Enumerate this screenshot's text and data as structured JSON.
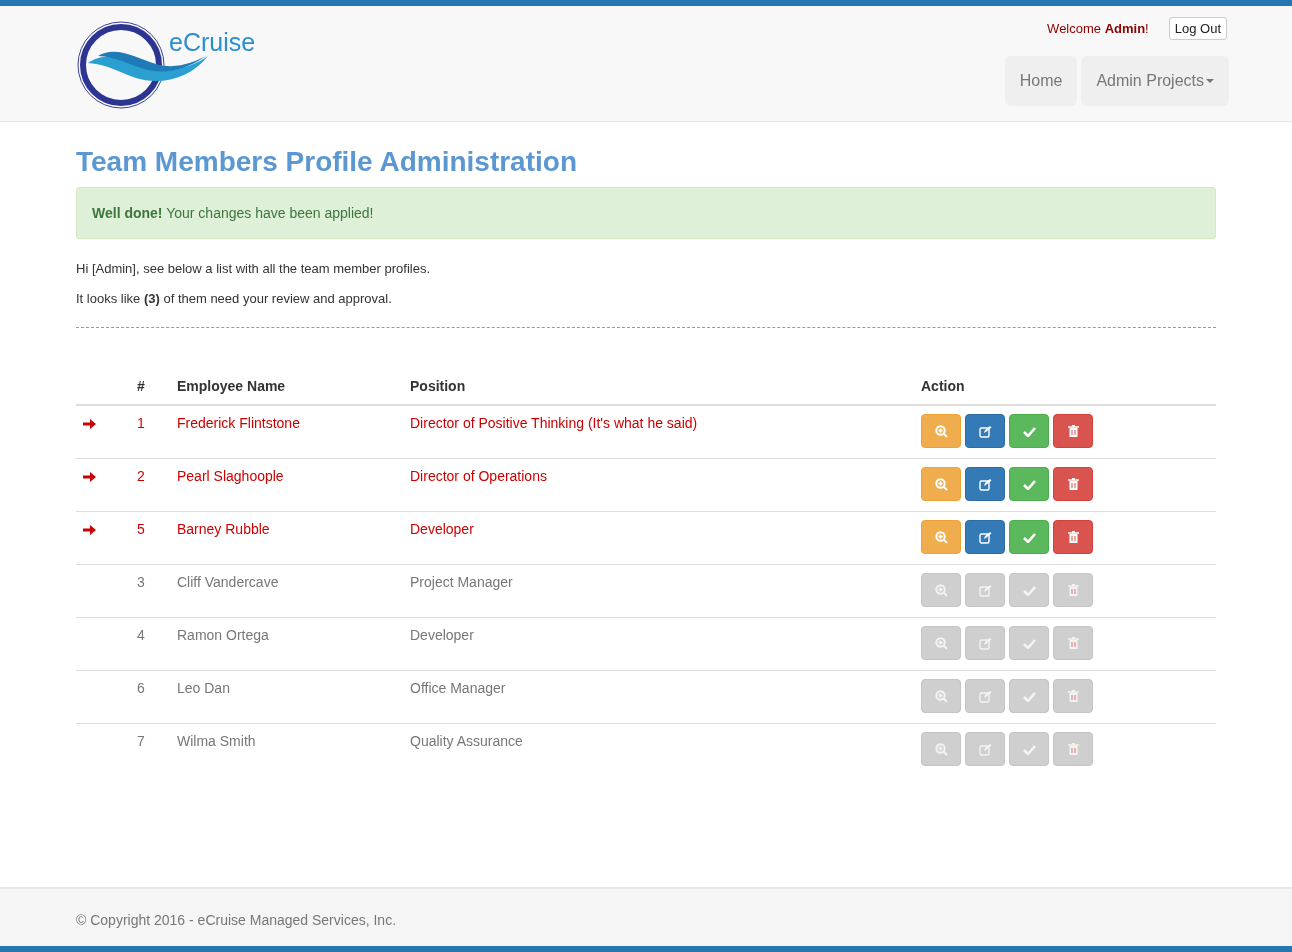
{
  "header": {
    "logo_text": "eCruise",
    "welcome": "Welcome **Admin**!",
    "logout": "Log Out",
    "nav": [
      {
        "label": "Home",
        "dropdown": false
      },
      {
        "label": "Admin Projects",
        "dropdown": true
      }
    ]
  },
  "page": {
    "title": "Team Members Profile Administration",
    "alert": "**Well done!** Your changes have been applied!",
    "intro": [
      "Hi [Admin], see below a list with all the team member profiles.",
      "It looks like **(3)** of them need your review and approval."
    ]
  },
  "table": {
    "columns": [
      "#",
      "Employee Name",
      "Position",
      "Action"
    ],
    "rows": [
      {
        "number": "1",
        "name": "Frederick Flintstone",
        "position": "Director of Positive Thinking (It's what he said)",
        "pending": true
      },
      {
        "number": "2",
        "name": "Pearl Slaghoople",
        "position": "Director of Operations",
        "pending": true
      },
      {
        "number": "5",
        "name": "Barney Rubble",
        "position": "Developer",
        "pending": true
      },
      {
        "number": "3",
        "name": "Cliff Vandercave",
        "position": "Project Manager",
        "pending": false
      },
      {
        "number": "4",
        "name": "Ramon Ortega",
        "position": "Developer",
        "pending": false
      },
      {
        "number": "6",
        "name": "Leo Dan",
        "position": "Office Manager",
        "pending": false
      },
      {
        "number": "7",
        "name": "Wilma Smith",
        "position": "Quality Assurance",
        "pending": false
      }
    ]
  },
  "footer": {
    "text": "© Copyright 2016 - eCruise Managed Services, Inc."
  }
}
